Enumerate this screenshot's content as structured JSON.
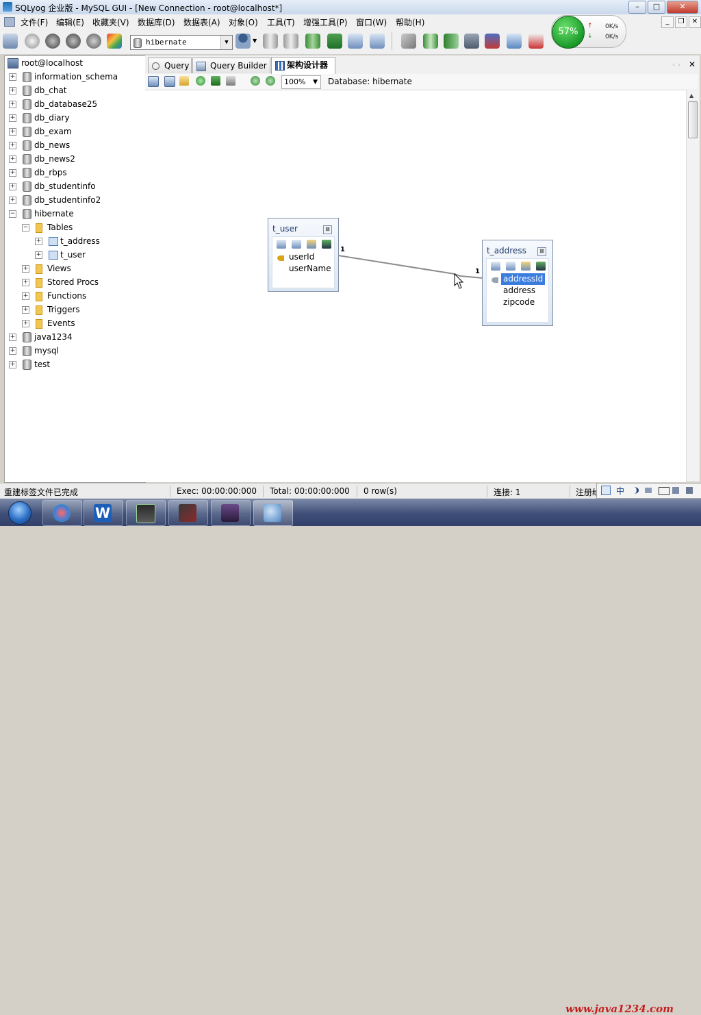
{
  "window": {
    "title": "SQLyog 企业版 - MySQL GUI - [New Connection - root@localhost*]",
    "minimize": "–",
    "maximize": "□",
    "close": "✕"
  },
  "menu": {
    "items": [
      "文件(F)",
      "编辑(E)",
      "收藏夹(V)",
      "数据库(D)",
      "数据表(A)",
      "对象(O)",
      "工具(T)",
      "增强工具(P)",
      "窗口(W)",
      "帮助(H)"
    ],
    "mdi_min": "_",
    "mdi_restore": "❐",
    "mdi_close": "✕"
  },
  "toolbar": {
    "database_selected": "hibernate",
    "dropdown_arrow": "▼"
  },
  "network_widget": {
    "cpu_percent": "57%",
    "up_arrow": "↑",
    "up_speed": "0K/s",
    "down_arrow": "↓",
    "down_speed": "0K/s"
  },
  "object_browser": {
    "root": "root@localhost",
    "databases": [
      "information_schema",
      "db_chat",
      "db_database25",
      "db_diary",
      "db_exam",
      "db_news",
      "db_news2",
      "db_rbps",
      "db_studentinfo",
      "db_studentinfo2",
      "hibernate",
      "java1234",
      "mysql",
      "test"
    ],
    "hibernate_children": {
      "tables_label": "Tables",
      "tables": [
        "t_address",
        "t_user"
      ],
      "others": [
        "Views",
        "Stored Procs",
        "Functions",
        "Triggers",
        "Events"
      ]
    },
    "expand_symbol": "+",
    "collapse_symbol": "−"
  },
  "tabs": {
    "items": [
      "Query",
      "Query Builder",
      "架构设计器"
    ],
    "active_index": 2,
    "nav": "‹ ›",
    "close": "✕"
  },
  "designer": {
    "zoom": "100%",
    "database_label": "Database: hibernate",
    "entities": {
      "t_user": {
        "name": "t_user",
        "fields": [
          "userId",
          "userName"
        ],
        "primary_key": "userId",
        "close_glyph": "⊠"
      },
      "t_address": {
        "name": "t_address",
        "fields": [
          "addressId",
          "address",
          "zipcode"
        ],
        "primary_key": "addressId",
        "selected_field": "addressId",
        "close_glyph": "⊠"
      }
    },
    "relation": {
      "from_cardinality": "1",
      "to_cardinality": "1"
    }
  },
  "statusbar": {
    "message": "重建标签文件已完成",
    "exec": "Exec: 00:00:00:000",
    "total": "Total: 00:00:00:000",
    "rows": "0 row(s)",
    "connections": "连接: 1",
    "registered": "注册给"
  },
  "ime_bar": {
    "label": "中"
  },
  "taskbar": {
    "watermark": "www.java1234.com"
  },
  "colors": {
    "selection": "#3b7ddd",
    "entity_border": "#7f8fa6",
    "watermark": "#c81e1e"
  }
}
